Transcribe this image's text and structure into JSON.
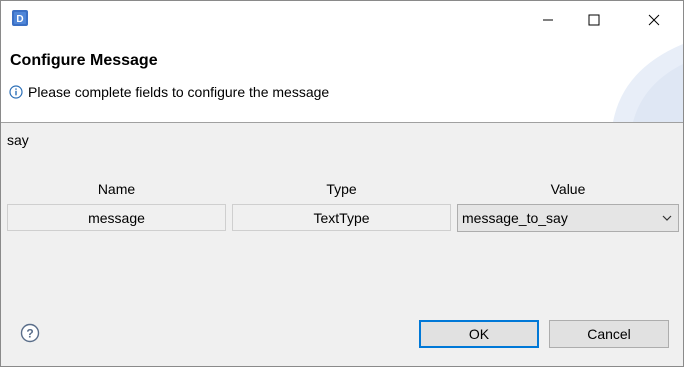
{
  "window": {
    "title": "",
    "icons": {
      "app": "app-logo-icon",
      "minimize": "minimize-icon",
      "maximize": "maximize-icon",
      "close": "close-icon"
    }
  },
  "header": {
    "title": "Configure Message",
    "info_icon": "info-icon",
    "info_text": "Please complete fields to configure the message"
  },
  "message_name": "say",
  "table": {
    "columns": [
      "Name",
      "Type",
      "Value"
    ],
    "rows": [
      {
        "name": "message",
        "type": "TextType",
        "value": "message_to_say"
      }
    ]
  },
  "footer": {
    "help_icon": "help-icon",
    "ok_label": "OK",
    "cancel_label": "Cancel"
  },
  "colors": {
    "accent": "#0078d7",
    "header_bg": "#ffffff",
    "body_bg": "#f0f0f0"
  }
}
